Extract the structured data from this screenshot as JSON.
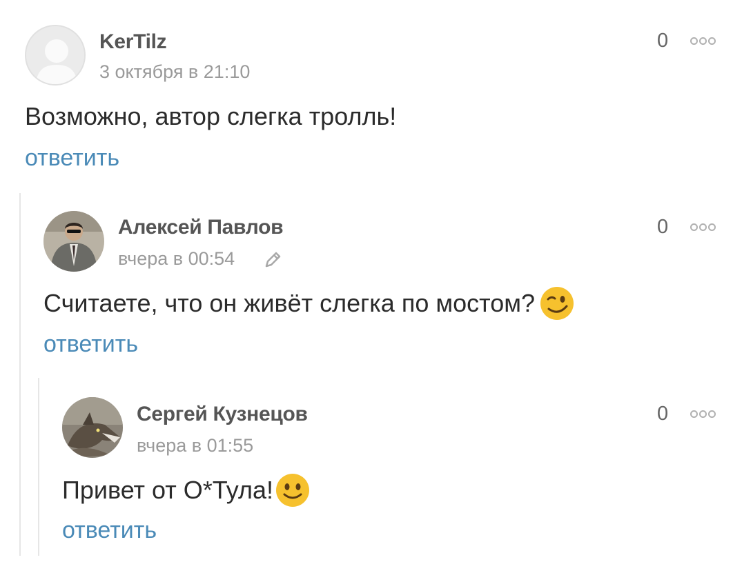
{
  "comments": [
    {
      "author": "KerTilz",
      "date": "3 октября в 21:10",
      "score": "0",
      "text": "Возможно, автор слегка тролль!",
      "reply": "ответить",
      "avatar_icon": "default-user-avatar"
    },
    {
      "author": "Алексей Павлов",
      "date": "вчера в 00:54",
      "score": "0",
      "text": "Считаете, что он живёт слегка по мостом?",
      "reply": "ответить",
      "edited_icon": "pencil-icon",
      "emoji": "winking-face-emoji",
      "avatar_icon": "man-in-suit-avatar"
    },
    {
      "author": "Сергей Кузнецов",
      "date": "вчера в 01:55",
      "score": "0",
      "text": "Привет от О*Тула!",
      "reply": "ответить",
      "emoji": "smiling-face-emoji",
      "avatar_icon": "wolf-avatar"
    }
  ],
  "colors": {
    "reply_link": "#4a8ab7",
    "author": "#555555",
    "date": "#9a9a9a",
    "thread_line": "#e6e6e6"
  }
}
